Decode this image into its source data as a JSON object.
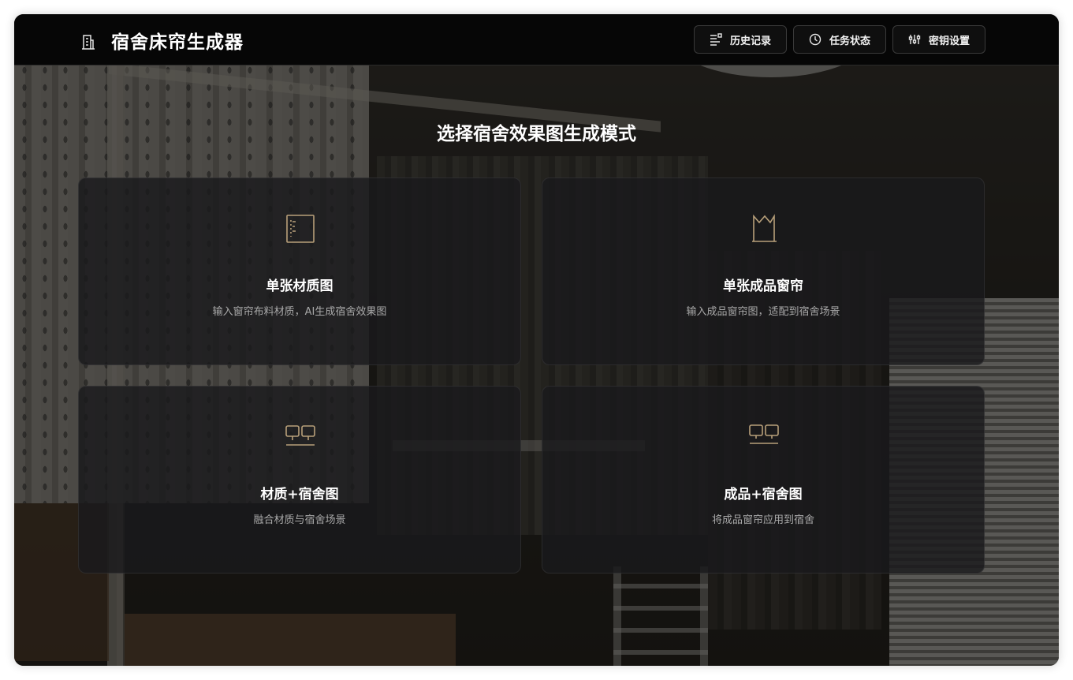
{
  "app": {
    "title": "宿舍床帘生成器",
    "logo_icon": "building-icon"
  },
  "nav": {
    "history": {
      "label": "历史记录",
      "icon": "list-icon"
    },
    "status": {
      "label": "任务状态",
      "icon": "clock-icon"
    },
    "keys": {
      "label": "密钥设置",
      "icon": "settings-icon"
    }
  },
  "main": {
    "heading": "选择宿舍效果图生成模式",
    "cards": [
      {
        "title": "单张材质图",
        "desc": "输入窗帘布料材质，AI生成宿舍效果图",
        "icon": "fabric-swatch-icon"
      },
      {
        "title": "单张成品窗帘",
        "desc": "输入成品窗帘图，适配到宿舍场景",
        "icon": "curtain-icon"
      },
      {
        "title": "材质+宿舍图",
        "desc": "融合材质与宿舍场景",
        "icon": "combine-images-icon"
      },
      {
        "title": "成品+宿舍图",
        "desc": "将成品窗帘应用到宿舍",
        "icon": "combine-images-icon"
      }
    ]
  },
  "colors": {
    "accent_icon": "#b8a07a",
    "header_bg": "#060606",
    "card_bg": "#1a1a1c",
    "text_primary": "#ffffff",
    "text_secondary": "#a9a9a9"
  }
}
